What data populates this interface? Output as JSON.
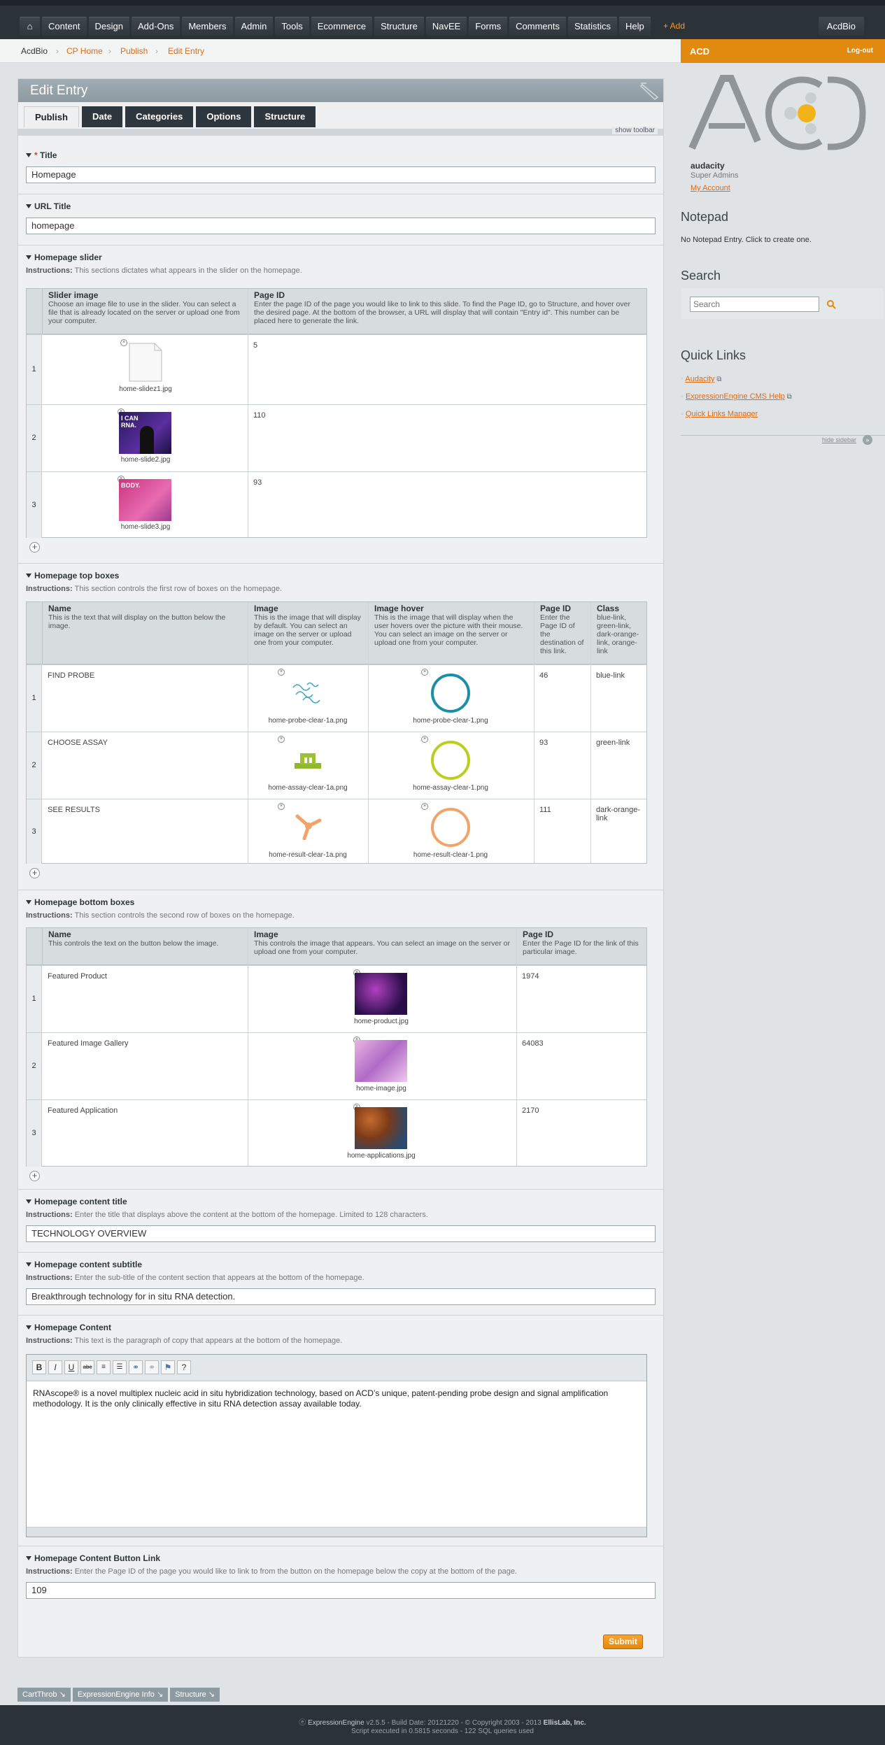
{
  "nav": {
    "home": "⌂",
    "items": [
      "Content",
      "Design",
      "Add-Ons",
      "Members",
      "Admin",
      "Tools",
      "Ecommerce",
      "Structure",
      "NavEE",
      "Forms",
      "Comments",
      "Statistics",
      "Help"
    ],
    "add": "+ Add",
    "site": "AcdBio"
  },
  "breadcrumb": [
    "AcdBio",
    "CP Home",
    "Publish",
    "Edit Entry"
  ],
  "page": {
    "title": "Edit Entry",
    "tabs": [
      "Publish",
      "Date",
      "Categories",
      "Options",
      "Structure"
    ],
    "show_toolbar": "show toolbar"
  },
  "fields": {
    "title": {
      "label": "Title",
      "required": "*",
      "value": "Homepage"
    },
    "url_title": {
      "label": "URL Title",
      "value": "homepage"
    },
    "slider": {
      "label": "Homepage slider",
      "instructions": "This sections dictates what appears in the slider on the homepage.",
      "col1": {
        "name": "Slider image",
        "desc": "Choose an image file to use in the slider. You can select a file that is already located on the server or upload one from your computer."
      },
      "col2": {
        "name": "Page ID",
        "desc": "Enter the page ID of the page you would like to link to this slide. To find the Page ID, go to Structure, and hover over the desired page. At the bottom of the browser, a URL will display that will contain \"Entry id\". This number can be placed here to generate the link."
      },
      "rows": [
        {
          "n": "1",
          "file": "home-slidez1.jpg",
          "pid": "5"
        },
        {
          "n": "2",
          "file": "home-slide2.jpg",
          "pid": "110"
        },
        {
          "n": "3",
          "file": "home-slide3.jpg",
          "pid": "93"
        }
      ]
    },
    "top_boxes": {
      "label": "Homepage top boxes",
      "instructions": "This section controls the first row of boxes on the homepage.",
      "cols": [
        {
          "name": "Name",
          "desc": "This is the text that will display on the button below the image."
        },
        {
          "name": "Image",
          "desc": "This is the image that will display by default. You can select an image on the server or upload one from your computer."
        },
        {
          "name": "Image hover",
          "desc": "This is the image that will display when the user hovers over the picture with their mouse. You can select an image on the server or upload one from your computer."
        },
        {
          "name": "Page ID",
          "desc": "Enter the Page ID of the destination of this link."
        },
        {
          "name": "Class",
          "desc": "blue-link, green-link, dark-orange-link, orange-link"
        }
      ],
      "rows": [
        {
          "n": "1",
          "name": "FIND PROBE",
          "img": "home-probe-clear-1a.png",
          "hover": "home-probe-clear-1.png",
          "pid": "46",
          "cls": "blue-link",
          "color": "#1b8fa6"
        },
        {
          "n": "2",
          "name": "CHOOSE ASSAY",
          "img": "home-assay-clear-1a.png",
          "hover": "home-assay-clear-1.png",
          "pid": "93",
          "cls": "green-link",
          "color": "#b9cf1e"
        },
        {
          "n": "3",
          "name": "SEE RESULTS",
          "img": "home-result-clear-1a.png",
          "hover": "home-result-clear-1.png",
          "pid": "111",
          "cls": "dark-orange-link",
          "color": "#f2a36a"
        }
      ]
    },
    "bottom_boxes": {
      "label": "Homepage bottom boxes",
      "instructions": "This section controls the second row of boxes on the homepage.",
      "cols": [
        {
          "name": "Name",
          "desc": "This controls the text on the button below the image."
        },
        {
          "name": "Image",
          "desc": "This controls the image that appears. You can select an image on the server or upload one from your computer."
        },
        {
          "name": "Page ID",
          "desc": "Enter the Page ID for the link of this particular image."
        }
      ],
      "rows": [
        {
          "n": "1",
          "name": "Featured Product",
          "img": "home-product.jpg",
          "pid": "1974"
        },
        {
          "n": "2",
          "name": "Featured Image Gallery",
          "img": "home-image.jpg",
          "pid": "64083"
        },
        {
          "n": "3",
          "name": "Featured Application",
          "img": "home-applications.jpg",
          "pid": "2170"
        }
      ]
    },
    "content_title": {
      "label": "Homepage content title",
      "instructions": "Enter the title that displays above the content at the bottom of the homepage. Limited to 128 characters.",
      "value": "TECHNOLOGY OVERVIEW"
    },
    "content_subtitle": {
      "label": "Homepage content subtitle",
      "instructions": "Enter the sub-title of the content section that appears at the bottom of the homepage.",
      "value": "Breakthrough technology for in situ RNA detection."
    },
    "content": {
      "label": "Homepage Content",
      "instructions": "This text is the paragraph of copy that appears at the bottom of the homepage.",
      "value": "RNAscope® is a novel multiplex nucleic acid in situ hybridization technology, based on ACD’s unique, patent-pending probe design and signal amplification methodology. It is the only clinically effective in situ RNA detection assay available today."
    },
    "button_link": {
      "label": "Homepage Content Button Link",
      "instructions": "Enter the Page ID of the page you would like to link to from the button on the homepage below the copy at the bottom of the page.",
      "value": "109"
    }
  },
  "instructions_label": "Instructions:",
  "submit": "Submit",
  "sidebar": {
    "site": "ACD",
    "logout": "Log-out",
    "username": "audacity",
    "role": "Super Admins",
    "account": "My Account",
    "notepad_title": "Notepad",
    "notepad_text": "No Notepad Entry. Click to create one.",
    "search_title": "Search",
    "search_placeholder": "Search",
    "quicklinks_title": "Quick Links",
    "links": [
      "Audacity",
      "ExpressionEngine CMS Help",
      "Quick Links Manager"
    ],
    "hide": "hide sidebar"
  },
  "footer_tabs": [
    "CartThrob",
    "ExpressionEngine Info",
    "Structure"
  ],
  "footer": {
    "line1_brand": "ExpressionEngine",
    "line1": "v2.5.5 - Build Date: 20121220 - © Copyright 2003 - 2013",
    "line1_company": "EllisLab, Inc.",
    "line2": "Script executed in 0.5815 seconds - 122 SQL queries used"
  },
  "colors": {
    "accent": "#e28a0f",
    "nav": "#2b3338"
  }
}
